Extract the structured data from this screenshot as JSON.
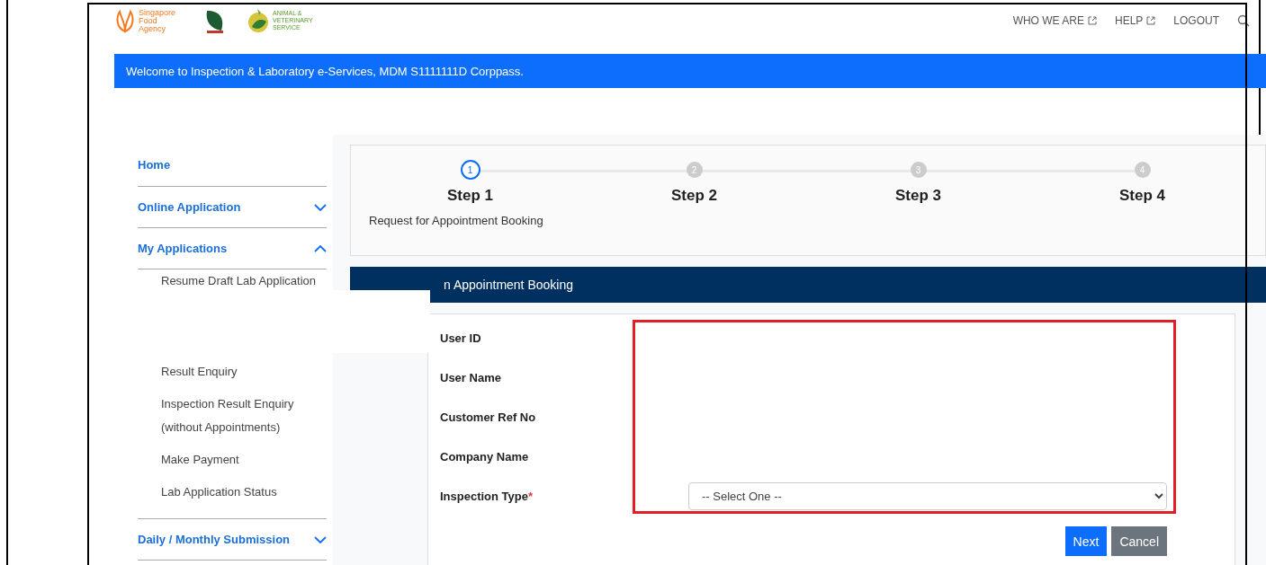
{
  "logos": [
    {
      "kind": "sfa",
      "text": "Singapore Food Agency"
    },
    {
      "kind": "nparks"
    },
    {
      "kind": "avs",
      "text": "ANIMAL & VETERINARY SERVICE"
    }
  ],
  "nav": [
    {
      "label": "WHO WE ARE",
      "external": true
    },
    {
      "label": "HELP",
      "external": true
    },
    {
      "label": "LOGOUT",
      "external": false
    }
  ],
  "welcome": "Welcome to Inspection & Laboratory e-Services, MDM S1111111D Corppass.",
  "sidebar": {
    "items": [
      {
        "label": "Home",
        "kind": "link"
      },
      {
        "label": "Online Application",
        "kind": "section",
        "expanded": false
      },
      {
        "label": "My Applications",
        "kind": "section",
        "expanded": true,
        "children": [
          {
            "label": "Resume Draft Lab Application"
          },
          {
            "label": "Result Enquiry",
            "gap": true
          },
          {
            "label": "Inspection Result Enquiry (without Appointments)"
          },
          {
            "label": "Make Payment"
          },
          {
            "label": "Lab Application Status"
          }
        ]
      },
      {
        "label": "Daily / Monthly Submission",
        "kind": "section",
        "expanded": false
      }
    ]
  },
  "stepper": {
    "steps": [
      {
        "number": "1",
        "label": "Step 1",
        "selected": true
      },
      {
        "number": "2",
        "label": "Step 2",
        "selected": false
      },
      {
        "number": "3",
        "label": "Step 3",
        "selected": false
      },
      {
        "number": "4",
        "label": "Step 4",
        "selected": false
      }
    ],
    "description": "Request for Appointment Booking"
  },
  "form": {
    "title": "n Appointment Booking",
    "fields": [
      {
        "label": "User ID"
      },
      {
        "label": "User Name"
      },
      {
        "label": "Customer Ref No"
      },
      {
        "label": "Company Name"
      },
      {
        "label": "Inspection Type",
        "required": true,
        "required_mark": "*",
        "kind": "select",
        "placeholder": "-- Select One --"
      }
    ],
    "buttons": [
      {
        "label": "Next",
        "kind": "primary"
      },
      {
        "label": "Cancel",
        "kind": "secondary"
      }
    ]
  }
}
